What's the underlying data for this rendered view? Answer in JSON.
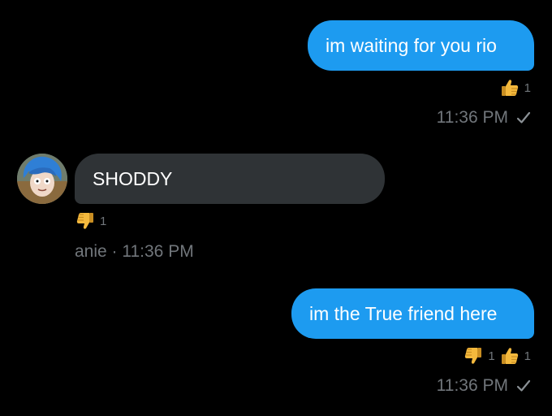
{
  "messages": [
    {
      "direction": "outgoing",
      "text": "im waiting for you rio",
      "reactions": [
        {
          "icon": "thumbs-up-icon",
          "count": "1"
        }
      ],
      "time": "11:36 PM",
      "status_icon": "check-icon"
    },
    {
      "direction": "incoming",
      "text": "SHODDY",
      "reactions": [
        {
          "icon": "thumbs-down-icon",
          "count": "1"
        }
      ],
      "meta": "anie · 11:36 PM"
    },
    {
      "direction": "outgoing",
      "text": "im the True friend here",
      "reactions": [
        {
          "icon": "thumbs-down-icon",
          "count": "1"
        },
        {
          "icon": "thumbs-up-icon",
          "count": "1"
        }
      ],
      "time": "11:36 PM",
      "status_icon": "check-icon"
    }
  ],
  "colors": {
    "background": "#000000",
    "outgoing_bubble": "#1d9bf0",
    "incoming_bubble": "#2f3336",
    "meta_text": "#71767b",
    "emoji_yellow": "#f4b93d"
  }
}
